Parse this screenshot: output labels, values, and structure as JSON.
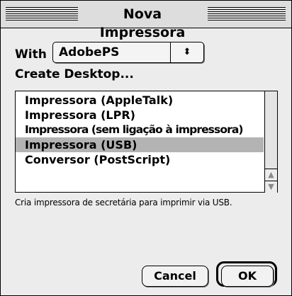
{
  "window": {
    "title": "Nova Impressora"
  },
  "with": {
    "label": "With",
    "selected": "AdobePS",
    "arrows": "⬍"
  },
  "create_label": "Create Desktop...",
  "list": {
    "items": [
      {
        "label": "Impressora (AppleTalk)",
        "selected": false
      },
      {
        "label": "Impressora (LPR)",
        "selected": false
      },
      {
        "label": "Impressora (sem ligação à impressora)",
        "selected": false
      },
      {
        "label": "Impressora (USB)",
        "selected": true
      },
      {
        "label": "Conversor (PostScript)",
        "selected": false
      }
    ],
    "scroll_up": "▲",
    "scroll_down": "▼"
  },
  "description": "Cria impressora de secretária para imprimir via USB.",
  "buttons": {
    "cancel": "Cancel",
    "ok": "OK"
  },
  "colors": {
    "selection": "#b3b3b3",
    "window_bg": "#ececec"
  }
}
